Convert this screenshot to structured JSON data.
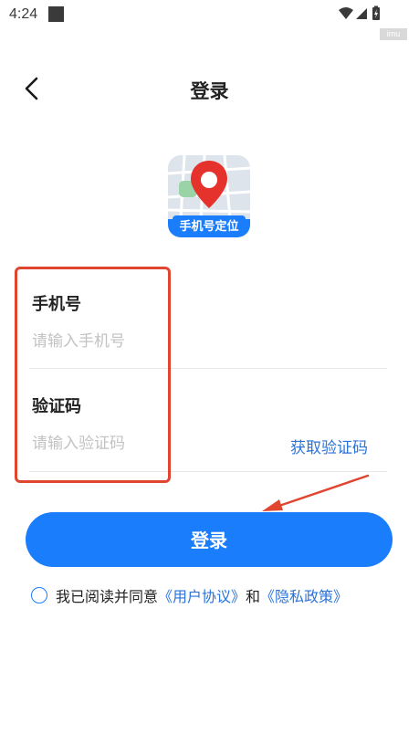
{
  "status_bar": {
    "time": "4:24",
    "tag": "imu"
  },
  "header": {
    "title": "登录"
  },
  "logo": {
    "text": "手机号定位"
  },
  "form": {
    "phone": {
      "label": "手机号",
      "placeholder": "请输入手机号",
      "value": ""
    },
    "code": {
      "label": "验证码",
      "placeholder": "请输入验证码",
      "value": "",
      "get_code_label": "获取验证码"
    }
  },
  "login_button": {
    "label": "登录"
  },
  "agreement": {
    "prefix": "我已阅读并同意",
    "user_agreement": "《用户协议》",
    "conjunction": "和",
    "privacy_policy": "《隐私政策》",
    "checked": false
  },
  "colors": {
    "accent": "#1a7dfb",
    "link": "#2a73d8",
    "highlight": "#e0452f",
    "pin": "#e5322d"
  },
  "icons": [
    "back-arrow-icon",
    "wifi-icon",
    "signal-icon",
    "battery-icon",
    "location-pin-icon",
    "arrow-annotation-icon"
  ]
}
